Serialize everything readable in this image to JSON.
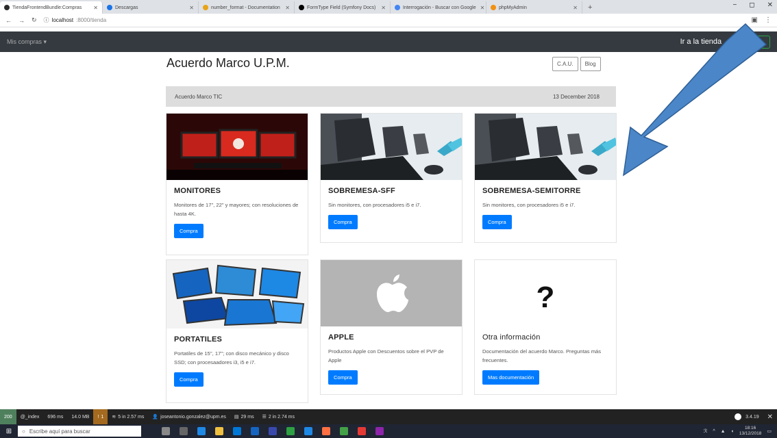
{
  "browser": {
    "tabs": [
      {
        "title": "TiendaFrontendBundle:Compras",
        "favicon_color": "#2b2b2b",
        "active": true
      },
      {
        "title": "Descargas",
        "favicon_color": "#1a73e8",
        "active": false
      },
      {
        "title": "number_format - Documentation",
        "favicon_color": "#e8a317",
        "active": false
      },
      {
        "title": "FormType Field (Symfony Docs)",
        "favicon_color": "#000000",
        "active": false
      },
      {
        "title": "Interrogación - Buscar con Google",
        "favicon_color": "#4285f4",
        "active": false
      },
      {
        "title": "phpMyAdmin",
        "favicon_color": "#f29111",
        "active": false
      }
    ],
    "url_host": "localhost",
    "url_path": ":8000/tienda"
  },
  "navbar": {
    "dropdown_label": "Mis compras ▾",
    "shop_label": "Ir a la tienda",
    "login_label": "sesión"
  },
  "page": {
    "title": "Acuerdo Marco U.P.M.",
    "cau_label": "C.A.U.",
    "blog_label": "Blog",
    "bar_left": "Acuerdo Marco TIC",
    "bar_right": "13 December 2018"
  },
  "cards": [
    {
      "title": "MONITORES",
      "text": "Monitores de 17\", 22\" y mayores; con resoluciones de hasta 4K.",
      "button": "Compra"
    },
    {
      "title": "SOBREMESA-SFF",
      "text": "Sin monitores, con procesadores i5 e i7.",
      "button": "Compra"
    },
    {
      "title": "SOBREMESA-SEMITORRE",
      "text": "Sin monitores, con procesadores i5 e i7.",
      "button": "Compra"
    },
    {
      "title": "PORTATILES",
      "text": "Portatiles de 15'', 17''; con disco mecánico y disco SSD; con procesaadores i3, i5 e i7.",
      "button": "Compra"
    },
    {
      "title": "APPLE",
      "text": "Productos Apple con Descuentos sobre el PVP de Apple",
      "button": "Compra"
    },
    {
      "title": "Otra información",
      "text": "Documentación del acuerdo Marco. Preguntas más frecuentes.",
      "button": "Mas documentación",
      "symbol": "?"
    }
  ],
  "debug": {
    "status": "200",
    "route": "@_index",
    "time": "696 ms",
    "memory": "14.0 MB",
    "errors": "1",
    "cache": "5 in 2.57 ms",
    "user": "joseantonio.gonzalez@upm.es",
    "twig": "29 ms",
    "db": "2 in 2.74 ms",
    "version": "3.4.19"
  },
  "taskbar": {
    "search_placeholder": "Escribe aquí para buscar",
    "time": "18:16",
    "date": "13/12/2018"
  },
  "colors": {
    "navbar": "#343a40",
    "primary": "#007bff",
    "arrow": "#4a86c8"
  }
}
